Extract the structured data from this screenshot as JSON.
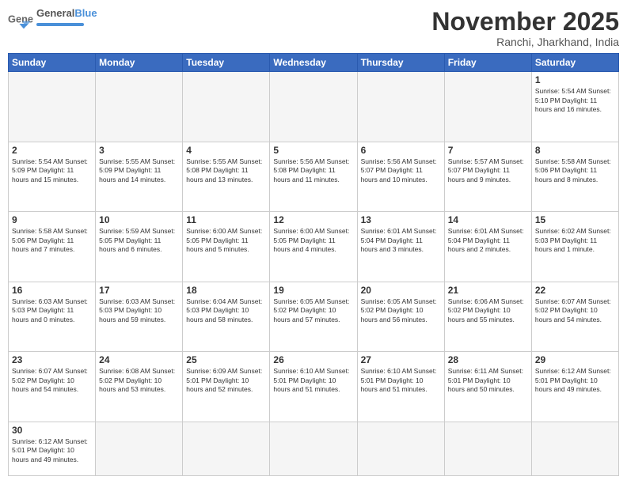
{
  "header": {
    "logo_general": "General",
    "logo_blue": "Blue",
    "month_title": "November 2025",
    "location": "Ranchi, Jharkhand, India"
  },
  "days": [
    "Sunday",
    "Monday",
    "Tuesday",
    "Wednesday",
    "Thursday",
    "Friday",
    "Saturday"
  ],
  "weeks": [
    [
      {
        "date": "",
        "info": ""
      },
      {
        "date": "",
        "info": ""
      },
      {
        "date": "",
        "info": ""
      },
      {
        "date": "",
        "info": ""
      },
      {
        "date": "",
        "info": ""
      },
      {
        "date": "",
        "info": ""
      },
      {
        "date": "1",
        "info": "Sunrise: 5:54 AM\nSunset: 5:10 PM\nDaylight: 11 hours and 16 minutes."
      }
    ],
    [
      {
        "date": "2",
        "info": "Sunrise: 5:54 AM\nSunset: 5:09 PM\nDaylight: 11 hours and 15 minutes."
      },
      {
        "date": "3",
        "info": "Sunrise: 5:55 AM\nSunset: 5:09 PM\nDaylight: 11 hours and 14 minutes."
      },
      {
        "date": "4",
        "info": "Sunrise: 5:55 AM\nSunset: 5:08 PM\nDaylight: 11 hours and 13 minutes."
      },
      {
        "date": "5",
        "info": "Sunrise: 5:56 AM\nSunset: 5:08 PM\nDaylight: 11 hours and 11 minutes."
      },
      {
        "date": "6",
        "info": "Sunrise: 5:56 AM\nSunset: 5:07 PM\nDaylight: 11 hours and 10 minutes."
      },
      {
        "date": "7",
        "info": "Sunrise: 5:57 AM\nSunset: 5:07 PM\nDaylight: 11 hours and 9 minutes."
      },
      {
        "date": "8",
        "info": "Sunrise: 5:58 AM\nSunset: 5:06 PM\nDaylight: 11 hours and 8 minutes."
      }
    ],
    [
      {
        "date": "9",
        "info": "Sunrise: 5:58 AM\nSunset: 5:06 PM\nDaylight: 11 hours and 7 minutes."
      },
      {
        "date": "10",
        "info": "Sunrise: 5:59 AM\nSunset: 5:05 PM\nDaylight: 11 hours and 6 minutes."
      },
      {
        "date": "11",
        "info": "Sunrise: 6:00 AM\nSunset: 5:05 PM\nDaylight: 11 hours and 5 minutes."
      },
      {
        "date": "12",
        "info": "Sunrise: 6:00 AM\nSunset: 5:05 PM\nDaylight: 11 hours and 4 minutes."
      },
      {
        "date": "13",
        "info": "Sunrise: 6:01 AM\nSunset: 5:04 PM\nDaylight: 11 hours and 3 minutes."
      },
      {
        "date": "14",
        "info": "Sunrise: 6:01 AM\nSunset: 5:04 PM\nDaylight: 11 hours and 2 minutes."
      },
      {
        "date": "15",
        "info": "Sunrise: 6:02 AM\nSunset: 5:03 PM\nDaylight: 11 hours and 1 minute."
      }
    ],
    [
      {
        "date": "16",
        "info": "Sunrise: 6:03 AM\nSunset: 5:03 PM\nDaylight: 11 hours and 0 minutes."
      },
      {
        "date": "17",
        "info": "Sunrise: 6:03 AM\nSunset: 5:03 PM\nDaylight: 10 hours and 59 minutes."
      },
      {
        "date": "18",
        "info": "Sunrise: 6:04 AM\nSunset: 5:03 PM\nDaylight: 10 hours and 58 minutes."
      },
      {
        "date": "19",
        "info": "Sunrise: 6:05 AM\nSunset: 5:02 PM\nDaylight: 10 hours and 57 minutes."
      },
      {
        "date": "20",
        "info": "Sunrise: 6:05 AM\nSunset: 5:02 PM\nDaylight: 10 hours and 56 minutes."
      },
      {
        "date": "21",
        "info": "Sunrise: 6:06 AM\nSunset: 5:02 PM\nDaylight: 10 hours and 55 minutes."
      },
      {
        "date": "22",
        "info": "Sunrise: 6:07 AM\nSunset: 5:02 PM\nDaylight: 10 hours and 54 minutes."
      }
    ],
    [
      {
        "date": "23",
        "info": "Sunrise: 6:07 AM\nSunset: 5:02 PM\nDaylight: 10 hours and 54 minutes."
      },
      {
        "date": "24",
        "info": "Sunrise: 6:08 AM\nSunset: 5:02 PM\nDaylight: 10 hours and 53 minutes."
      },
      {
        "date": "25",
        "info": "Sunrise: 6:09 AM\nSunset: 5:01 PM\nDaylight: 10 hours and 52 minutes."
      },
      {
        "date": "26",
        "info": "Sunrise: 6:10 AM\nSunset: 5:01 PM\nDaylight: 10 hours and 51 minutes."
      },
      {
        "date": "27",
        "info": "Sunrise: 6:10 AM\nSunset: 5:01 PM\nDaylight: 10 hours and 51 minutes."
      },
      {
        "date": "28",
        "info": "Sunrise: 6:11 AM\nSunset: 5:01 PM\nDaylight: 10 hours and 50 minutes."
      },
      {
        "date": "29",
        "info": "Sunrise: 6:12 AM\nSunset: 5:01 PM\nDaylight: 10 hours and 49 minutes."
      }
    ],
    [
      {
        "date": "30",
        "info": "Sunrise: 6:12 AM\nSunset: 5:01 PM\nDaylight: 10 hours and 49 minutes."
      },
      {
        "date": "",
        "info": ""
      },
      {
        "date": "",
        "info": ""
      },
      {
        "date": "",
        "info": ""
      },
      {
        "date": "",
        "info": ""
      },
      {
        "date": "",
        "info": ""
      },
      {
        "date": "",
        "info": ""
      }
    ]
  ]
}
